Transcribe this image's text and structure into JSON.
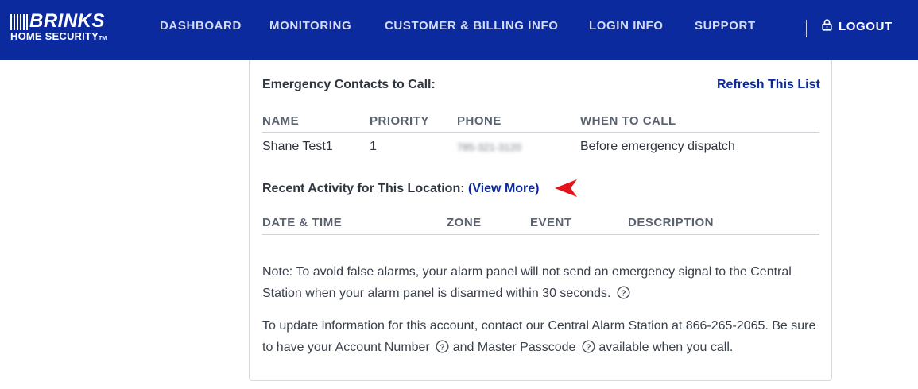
{
  "brand": {
    "name": "BRINKS",
    "subtitle": "HOME SECURITY",
    "trademark": "TM"
  },
  "nav": {
    "items": [
      {
        "label": "DASHBOARD"
      },
      {
        "label": "MONITORING"
      },
      {
        "label": "CUSTOMER & BILLING INFO"
      },
      {
        "label": "LOGIN INFO"
      },
      {
        "label": "SUPPORT"
      }
    ],
    "logout_label": "LOGOUT",
    "logout_icon": "lock-icon"
  },
  "contacts": {
    "title": "Emergency Contacts to Call:",
    "refresh_label": "Refresh This List",
    "columns": [
      "NAME",
      "PRIORITY",
      "PHONE",
      "WHEN TO CALL"
    ],
    "rows": [
      {
        "name": "Shane Test1",
        "priority": "1",
        "phone": "785-321-3120",
        "when": "Before emergency dispatch"
      }
    ]
  },
  "activity": {
    "title": "Recent Activity for This Location:",
    "view_more_label": "(View More)",
    "columns": [
      "DATE & TIME",
      "ZONE",
      "EVENT",
      "DESCRIPTION"
    ]
  },
  "notes": {
    "false_alarm": "Note: To avoid false alarms, your alarm panel will not send an emergency signal to the Central Station when your alarm panel is disarmed within 30 seconds.",
    "update_intro": "To update information for this account, contact our Central Alarm Station at 866-265-2065. Be sure to have your Account Number",
    "update_mid": "and Master Passcode",
    "update_end": "available when you call."
  },
  "colors": {
    "header_bg": "#0b2a9e",
    "link": "#0b2a9e",
    "annotation_arrow": "#e5141b"
  }
}
